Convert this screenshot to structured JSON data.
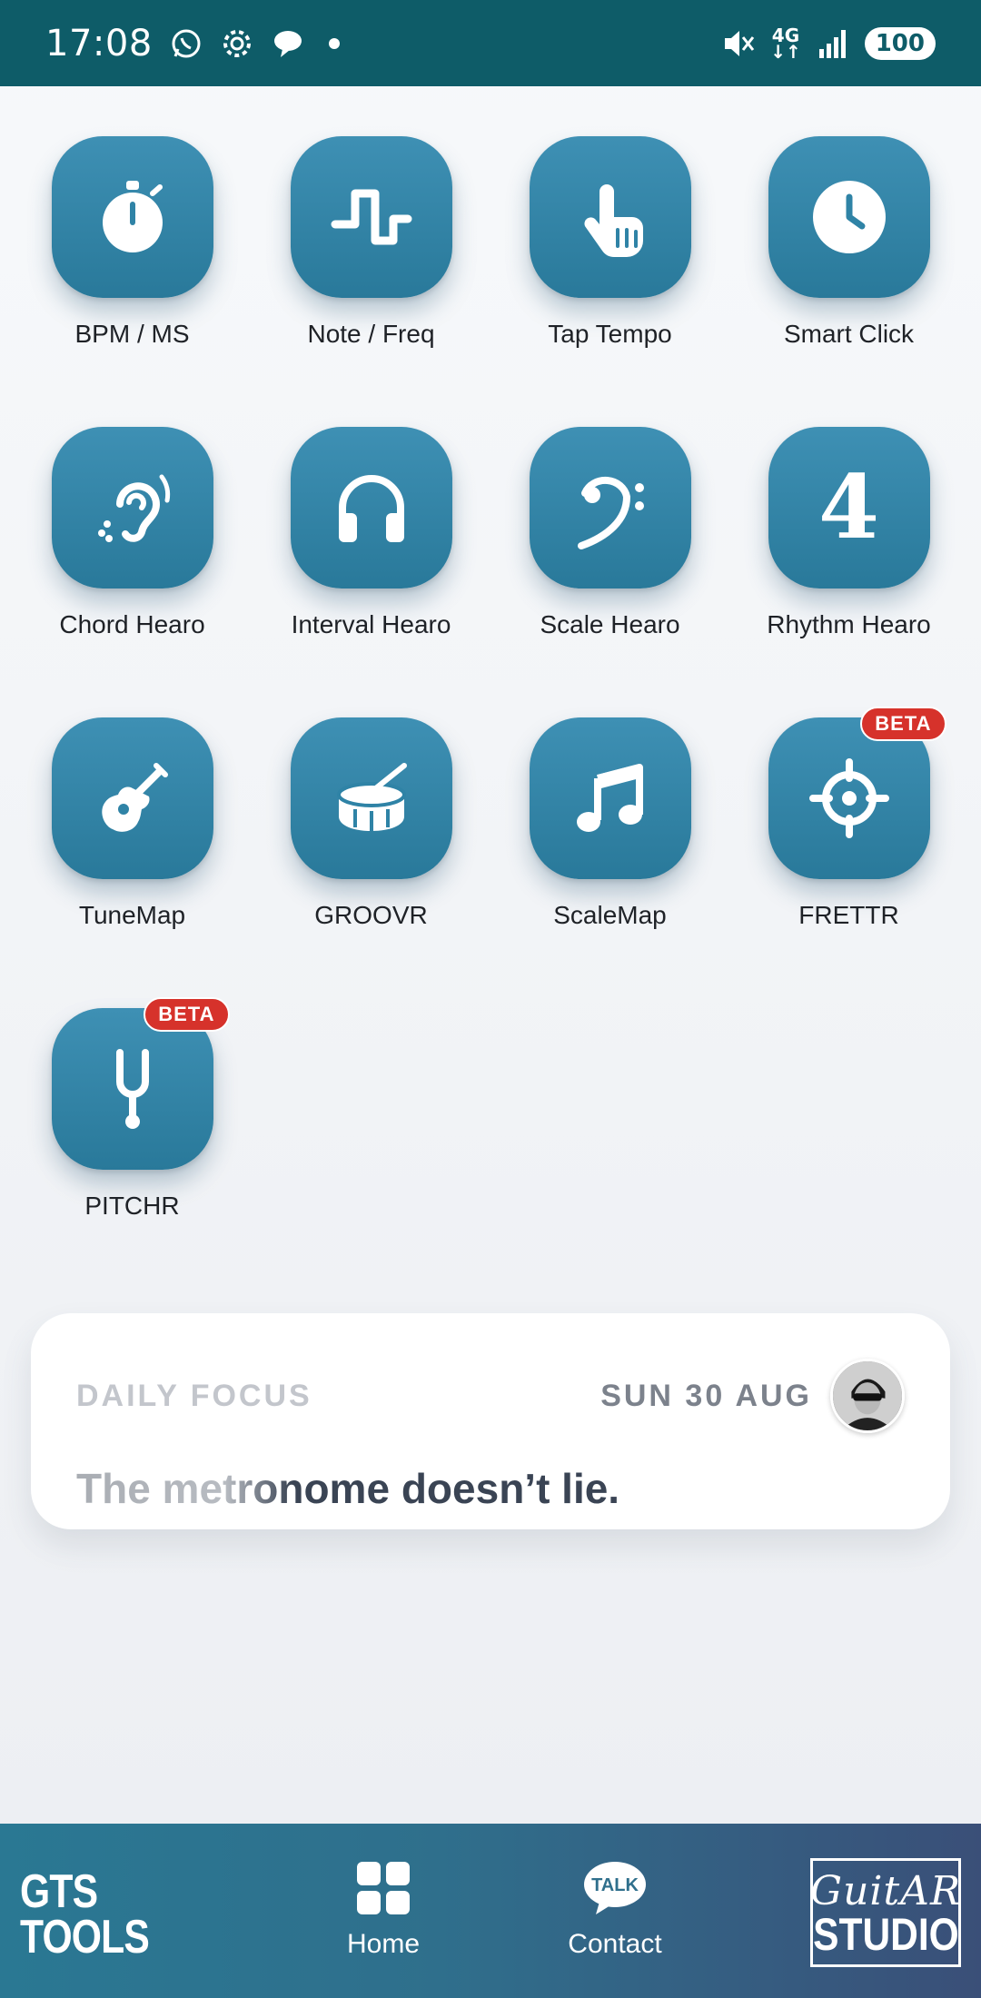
{
  "status_bar": {
    "time": "17:08",
    "network": "4G",
    "battery": "100",
    "icons": [
      "whatsapp-icon",
      "settings-icon",
      "chat-icon",
      "dot-icon",
      "mute-icon",
      "signal-icon"
    ]
  },
  "apps": [
    {
      "label": "BPM / MS",
      "icon": "stopwatch-icon"
    },
    {
      "label": "Note / Freq",
      "icon": "square-wave-icon"
    },
    {
      "label": "Tap Tempo",
      "icon": "tap-hand-icon"
    },
    {
      "label": "Smart Click",
      "icon": "clock-icon"
    },
    {
      "label": "Chord Hearo",
      "icon": "ear-icon"
    },
    {
      "label": "Interval Hearo",
      "icon": "headphones-icon"
    },
    {
      "label": "Scale Hearo",
      "icon": "bass-clef-icon"
    },
    {
      "label": "Rhythm Hearo",
      "icon": "number-four-icon",
      "glyph": "4"
    },
    {
      "label": "TuneMap",
      "icon": "guitar-icon"
    },
    {
      "label": "GROOVR",
      "icon": "drum-icon"
    },
    {
      "label": "ScaleMap",
      "icon": "music-note-icon"
    },
    {
      "label": "FRETTR",
      "icon": "crosshair-icon",
      "badge": "BETA"
    },
    {
      "label": "PITCHR",
      "icon": "tuning-fork-icon",
      "badge": "BETA"
    }
  ],
  "daily_focus": {
    "label": "DAILY FOCUS",
    "date": "SUN 30 AUG",
    "quote": "The metronome doesn’t lie."
  },
  "bottom_nav": {
    "brand_left_line1": "GTS",
    "brand_left_line2": "TOOLS",
    "home_label": "Home",
    "contact_label": "Contact",
    "talk_label": "TALK",
    "brand_right_line1": "GuitAR",
    "brand_right_line2": "STUDIO"
  },
  "colors": {
    "status_bar": "#0e5c68",
    "icon_tile": "#2f83a6",
    "beta_badge": "#d6322b",
    "nav_gradient_start": "#2a7893",
    "nav_gradient_end": "#3a4f78"
  }
}
